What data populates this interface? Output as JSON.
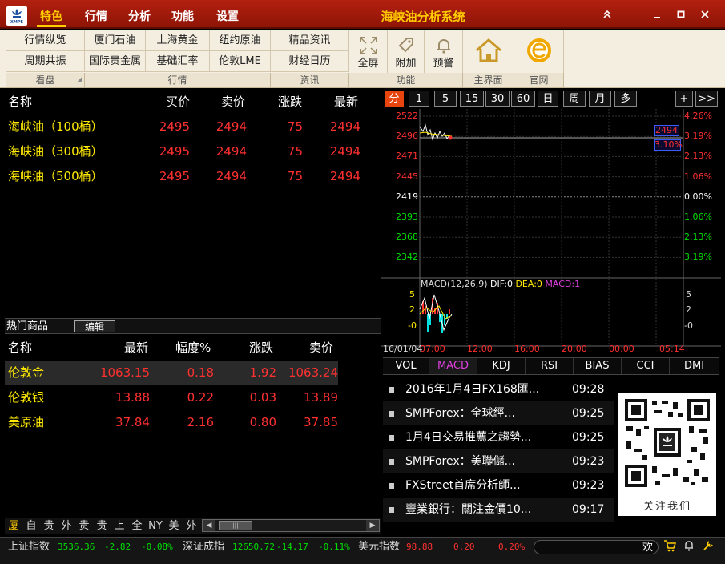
{
  "titlebar": {
    "app_title": "海峡油分析系统",
    "menus": [
      "特色",
      "行情",
      "分析",
      "功能",
      "设置"
    ],
    "logo_text": "XMPE"
  },
  "toolbar": {
    "row1": [
      "行情纵览",
      "厦门石油",
      "上海黄金",
      "纽约原油",
      "精品资讯"
    ],
    "row2": [
      "周期共振",
      "国际贵金属",
      "基础汇率",
      "伦敦LME",
      "财经日历"
    ],
    "big": [
      "全屏",
      "附加",
      "预警"
    ],
    "groups": [
      "看盘",
      "行情",
      "资讯",
      "功能",
      "主界面",
      "官网"
    ]
  },
  "quotes": {
    "headers": [
      "名称",
      "买价",
      "卖价",
      "涨跌",
      "最新"
    ],
    "rows": [
      {
        "name": "海峡油（100桶）",
        "buy": "2495",
        "sell": "2494",
        "chg": "75",
        "last": "2494"
      },
      {
        "name": "海峡油（300桶）",
        "buy": "2495",
        "sell": "2494",
        "chg": "75",
        "last": "2494"
      },
      {
        "name": "海峡油（500桶）",
        "buy": "2495",
        "sell": "2494",
        "chg": "75",
        "last": "2494"
      }
    ]
  },
  "hot": {
    "title": "热门商品",
    "edit": "编辑",
    "headers": [
      "名称",
      "最新",
      "幅度%",
      "涨跌",
      "卖价"
    ],
    "rows": [
      {
        "name": "伦敦金",
        "last": "1063.15",
        "pct": "0.18",
        "chg": "1.92",
        "sell": "1063.24"
      },
      {
        "name": "伦敦银",
        "last": "13.88",
        "pct": "0.22",
        "chg": "0.03",
        "sell": "13.89"
      },
      {
        "name": "美原油",
        "last": "37.84",
        "pct": "2.16",
        "chg": "0.80",
        "sell": "37.85"
      }
    ]
  },
  "bottom_tabs": [
    "厦",
    "自",
    "贵",
    "外",
    "贵",
    "贵",
    "上",
    "全",
    "NY",
    "美",
    "外"
  ],
  "chart": {
    "periods": [
      "分",
      "1",
      "5",
      "15",
      "30",
      "60",
      "日",
      "周",
      "月",
      "多"
    ],
    "nav": [
      "+",
      ">>"
    ],
    "price_labels": [
      {
        "v": "2522",
        "c": "#ff3030"
      },
      {
        "v": "2496",
        "c": "#ff3030"
      },
      {
        "v": "2471",
        "c": "#ff3030"
      },
      {
        "v": "2445",
        "c": "#ff3030"
      },
      {
        "v": "2419",
        "c": "#ffffff"
      },
      {
        "v": "2393",
        "c": "#00e000"
      },
      {
        "v": "2368",
        "c": "#00e000"
      },
      {
        "v": "2342",
        "c": "#00e000"
      }
    ],
    "pct_labels": [
      {
        "v": "4.26%",
        "c": "#ff3030"
      },
      {
        "v": "3.19%",
        "c": "#ff3030"
      },
      {
        "v": "2.13%",
        "c": "#ff3030"
      },
      {
        "v": "1.06%",
        "c": "#ff3030"
      },
      {
        "v": "0.00%",
        "c": "#ffffff"
      },
      {
        "v": "1.06%",
        "c": "#00e000"
      },
      {
        "v": "2.13%",
        "c": "#00e000"
      },
      {
        "v": "3.19%",
        "c": "#00e000"
      }
    ],
    "price_tag": "2494",
    "pct_tag": "3.10%",
    "macd_title": "MACD(12,26,9)",
    "dif": "DIF:0",
    "dea": "DEA:0",
    "macd": "MACD:1",
    "macd_ticks": [
      "5",
      "2",
      "-0"
    ],
    "macd_ticks_right": [
      "5",
      "2",
      "-0"
    ],
    "date": "16/01/04",
    "times": [
      "07:00",
      "12:00",
      "16:00",
      "20:00",
      "00:00",
      "05:14"
    ],
    "indicators": [
      "VOL",
      "MACD",
      "KDJ",
      "RSI",
      "BIAS",
      "CCI",
      "DMI"
    ]
  },
  "news": [
    {
      "title": "2016年1月4日FX168匯...",
      "time": "09:28"
    },
    {
      "title": "SMPForex：全球經...",
      "time": "09:25"
    },
    {
      "title": "1月4日交易推薦之趨勢...",
      "time": "09:25"
    },
    {
      "title": "SMPForex：美聯儲...",
      "time": "09:23"
    },
    {
      "title": "FXStreet首席分析師...",
      "time": "09:23"
    },
    {
      "title": "豐業銀行：關注金價10...",
      "time": "09:17"
    }
  ],
  "qr_caption": "关注我们",
  "status": {
    "sh_label": "上证指数",
    "sh_val": "3536.36",
    "sh_chg": "-2.82",
    "sh_pct": "-0.08%",
    "sz_label": "深证成指",
    "sz_val": "12650.72",
    "sz_chg": "-14.17",
    "sz_pct": "-0.11%",
    "usd_label": "美元指数",
    "usd_val": "98.88",
    "usd_chg": "0.20",
    "usd_pct": "0.20%",
    "welcome": "欢"
  },
  "colors": {
    "accent": "#e8450e",
    "titlebar": "#a31b0a",
    "up": "#ff3030",
    "down": "#00e000",
    "name": "#ffea00"
  }
}
